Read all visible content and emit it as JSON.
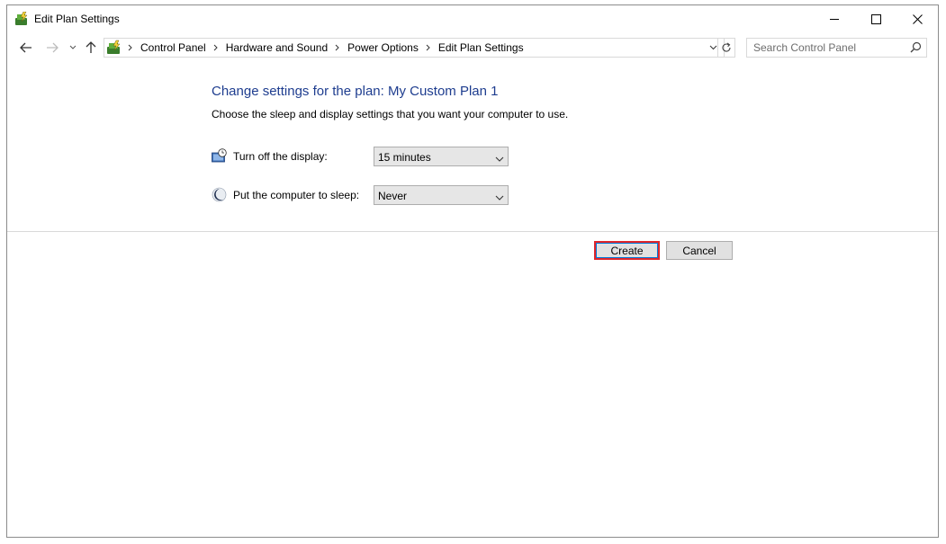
{
  "window": {
    "title": "Edit Plan Settings"
  },
  "nav": {
    "breadcrumbs": [
      "Control Panel",
      "Hardware and Sound",
      "Power Options",
      "Edit Plan Settings"
    ],
    "search_placeholder": "Search Control Panel"
  },
  "content": {
    "heading": "Change settings for the plan: My Custom Plan 1",
    "subtext": "Choose the sleep and display settings that you want your computer to use.",
    "display": {
      "label": "Turn off the display:",
      "value": "15 minutes"
    },
    "sleep": {
      "label": "Put the computer to sleep:",
      "value": "Never"
    }
  },
  "buttons": {
    "create": "Create",
    "cancel": "Cancel"
  },
  "colors": {
    "heading": "#1e3d8f",
    "highlight": "#e0262b"
  }
}
